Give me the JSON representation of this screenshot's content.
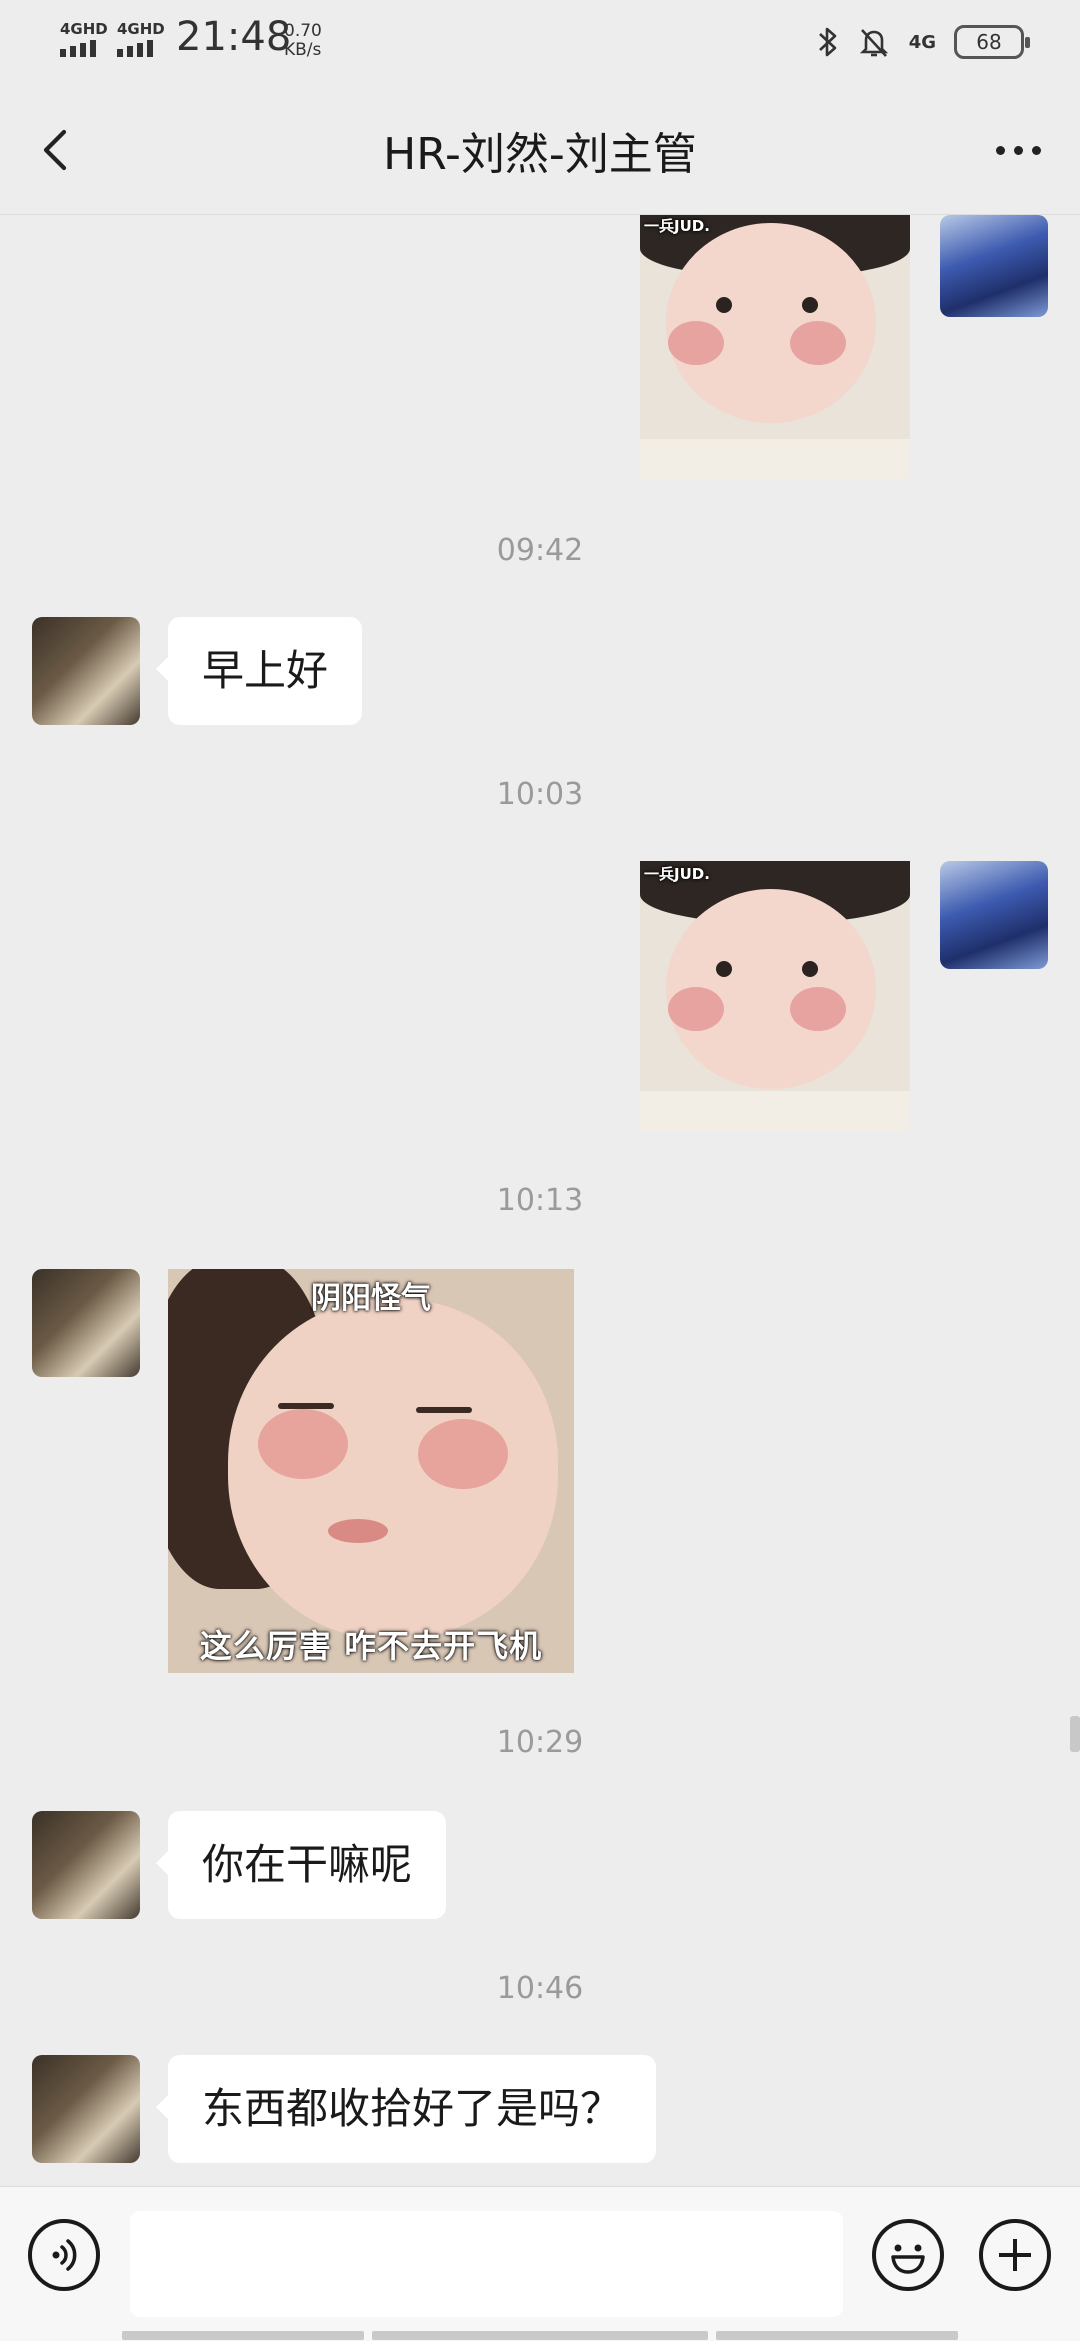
{
  "status_bar": {
    "signal1": "4GHD",
    "signal2": "4GHD",
    "time": "21:48",
    "net_speed_value": "0.70",
    "net_speed_unit": "KB/s",
    "network": "4G",
    "battery": "68",
    "icons": [
      "bluetooth-icon",
      "mute-bell-icon",
      "battery-icon"
    ]
  },
  "header": {
    "title": "HR-刘然-刘主管",
    "back_icon": "chevron-left-icon",
    "more_icon": "more-dots-icon"
  },
  "messages": [
    {
      "type": "sticker",
      "sender": "self",
      "watermark": "一兵JUD."
    },
    {
      "type": "timestamp",
      "text": "09:42"
    },
    {
      "type": "text",
      "sender": "other",
      "text": "早上好"
    },
    {
      "type": "timestamp",
      "text": "10:03"
    },
    {
      "type": "sticker",
      "sender": "self",
      "watermark": "一兵JUD."
    },
    {
      "type": "timestamp",
      "text": "10:13"
    },
    {
      "type": "sticker",
      "sender": "other",
      "top_caption": "阴阳怪气",
      "bottom_caption": "这么厉害 咋不去开飞机"
    },
    {
      "type": "timestamp",
      "text": "10:29"
    },
    {
      "type": "text",
      "sender": "other",
      "text": "你在干嘛呢"
    },
    {
      "type": "timestamp",
      "text": "10:46"
    },
    {
      "type": "text",
      "sender": "other",
      "text": "东西都收拾好了是吗？"
    }
  ],
  "input_bar": {
    "placeholder": "",
    "icons": [
      "voice-icon",
      "emoji-icon",
      "plus-icon"
    ]
  },
  "colors": {
    "background": "#ededed",
    "bubble": "#ffffff",
    "timestamp": "#9a9a9a"
  }
}
